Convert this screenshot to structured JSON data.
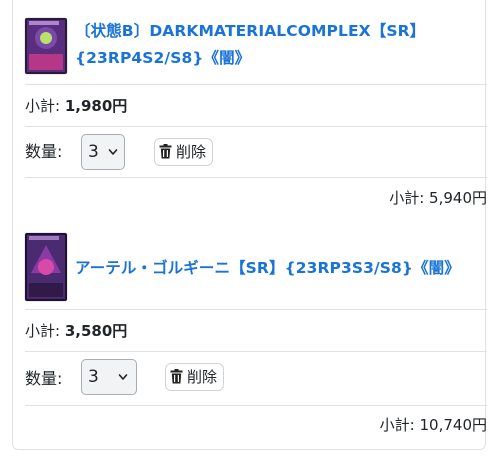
{
  "cart": {
    "items": [
      {
        "title_line1": "〔状態B〕DARKMATERIALCOMPLEX【SR】",
        "title_line2": "{23RP4S2/S8}《闇》",
        "unit_label": "小計: ",
        "unit_price": "1,980円",
        "qty_label": "数量: ",
        "qty_value": "3",
        "delete_label": "削除",
        "total_label": "小計: ",
        "total_value": "5,940円",
        "thumb_colors": [
          "#2a1a3a",
          "#7a4aa8",
          "#b9e26a",
          "#d63a8c"
        ]
      },
      {
        "title_line1": "アーテル・ゴルギーニ【SR】{23RP3S3/S8}《闇》",
        "title_line2": "",
        "unit_label": "小計: ",
        "unit_price": "3,580円",
        "qty_label": "数量: ",
        "qty_value": "3",
        "delete_label": "削除",
        "total_label": "小計: ",
        "total_value": "10,740円",
        "thumb_colors": [
          "#1e1230",
          "#8a3aa0",
          "#d84aa8",
          "#4a2a70"
        ]
      }
    ]
  },
  "colors": {
    "link": "#1a73d6",
    "border": "#dee2e6",
    "text": "#212529"
  }
}
